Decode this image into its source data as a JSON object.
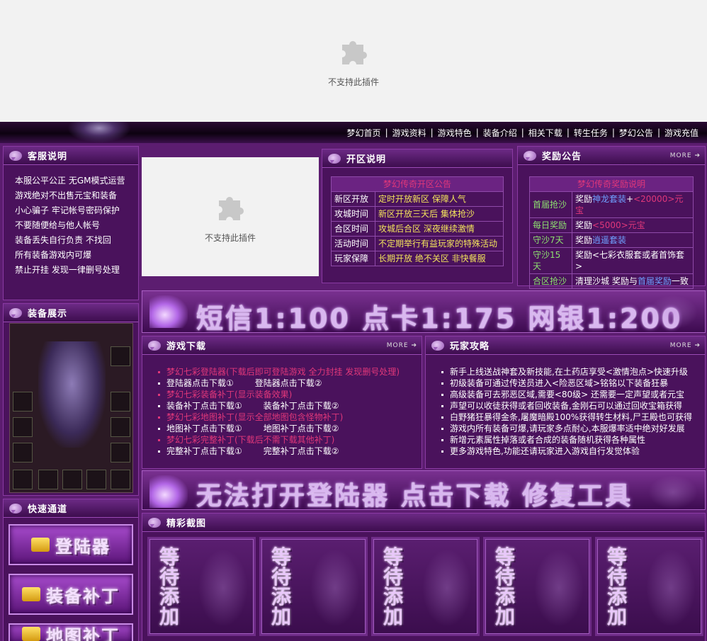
{
  "plugin_notice": "不支持此插件",
  "nav": [
    "梦幻首页",
    "游戏资料",
    "游戏特色",
    "装备介绍",
    "相关下载",
    "转生任务",
    "梦幻公告",
    "游戏充值"
  ],
  "kefu": {
    "title": "客服说明",
    "items": [
      "本服公平公正 无GM模式运营",
      "游戏绝对不出售元宝和装备",
      "小心骗子 牢记帐号密码保护",
      "不要随便给与他人帐号",
      "装备丢失自行负责 不找回",
      "所有装备游戏内可爆",
      "禁止开挂 发现一律删号处理"
    ]
  },
  "kaiqu": {
    "title": "开区说明",
    "caption": "梦幻传奇开区公告",
    "rows": [
      {
        "k": "新区开放",
        "v": "定时开放新区 保障人气"
      },
      {
        "k": "攻城时间",
        "v": "新区开放三天后 集体抢沙"
      },
      {
        "k": "合区时间",
        "v": "攻城后合区 深夜继续激情"
      },
      {
        "k": "活动时间",
        "v": "不定期举行有益玩家的特殊活动"
      },
      {
        "k": "玩家保障",
        "v": "长期开放 绝不关区 非快餐服"
      }
    ]
  },
  "jiangli": {
    "title": "奖励公告",
    "more": "MORE",
    "caption": "梦幻传奇奖励说明",
    "rows": [
      {
        "k": "首届抢沙",
        "a": "奖励",
        "b": "神龙套装",
        "c": "+",
        "d": "<20000>元宝"
      },
      {
        "k": "每日奖励",
        "a": "奖励",
        "b": "<5000>元宝",
        "c": "",
        "d": ""
      },
      {
        "k": "守沙7天",
        "a": "奖励",
        "b": "逍遥套装",
        "c": "",
        "d": ""
      },
      {
        "k": "守沙15天",
        "a": "奖励<七彩衣服套或者首饰套>",
        "b": "",
        "c": "",
        "d": ""
      },
      {
        "k": "合区抢沙",
        "a": "清理沙城 奖励与",
        "b": "首届奖励",
        "c": "一致",
        "d": ""
      }
    ]
  },
  "rates_banner": "短信1:100 点卡1:175 网银1:200",
  "download": {
    "title": "游戏下载",
    "more": "MORE",
    "items": [
      {
        "red": true,
        "a": "梦幻七彩登陆器(下载后即可登陆游戏 全力封挂 发现删号处理)",
        "b": ""
      },
      {
        "red": false,
        "a": "登陆器点击下载①",
        "b": "登陆器点击下载②"
      },
      {
        "red": true,
        "a": "梦幻七彩装备补丁(显示装备效果)",
        "b": ""
      },
      {
        "red": false,
        "a": "装备补丁点击下载①",
        "b": "装备补丁点击下载②"
      },
      {
        "red": true,
        "a": "梦幻七彩地图补丁(显示全部地图包含怪物补丁)",
        "b": ""
      },
      {
        "red": false,
        "a": "地图补丁点击下载①",
        "b": "地图补丁点击下载②"
      },
      {
        "red": true,
        "a": "梦幻七彩完整补丁(下载后不需下载其他补丁)",
        "b": ""
      },
      {
        "red": false,
        "a": "完整补丁点击下载①",
        "b": "完整补丁点击下载②"
      }
    ]
  },
  "gonglue": {
    "title": "玩家攻略",
    "more": "MORE",
    "items": [
      "新手上线送战神套及新技能,在土药店享受<激情泡点>快速升级",
      "初级装备可通过传送员进入<险恶区域>铭铭以下装备狂暴",
      "高级装备可去邪恶区域,需要<80级> 还需要一定声望或者元宝",
      "声望可以收徒获得或者回收装备,金刚石可以通过回收宝箱获得",
      "白野猪狂暴得金条,屠魔暗殿100%获得转生材料,尸王殿也可获得",
      "游戏内所有装备可爆,请玩家多点耐心,本服爆率适中绝对好发展",
      "新增元素属性掉落或者合成的装备随机获得各种属性",
      "更多游戏特色,功能还请玩家进入游戏自行发觉体验"
    ]
  },
  "fix_banner": "无法打开登陆器 点击下载 修复工具",
  "equip_title": "装备展示",
  "quick": {
    "title": "快速通道",
    "buttons": [
      "登陆器",
      "装备补丁",
      "地图补丁"
    ]
  },
  "gallery": {
    "title": "精彩截图",
    "tiles": [
      "等待添加",
      "等待添加",
      "等待添加",
      "等待添加",
      "等待添加"
    ]
  },
  "colors": {
    "bg": "#5c1d70",
    "accent_red": "#e0377a",
    "link_blue": "#6fa0ff",
    "text_yellow": "#f2e35c",
    "text_green": "#8de070"
  }
}
